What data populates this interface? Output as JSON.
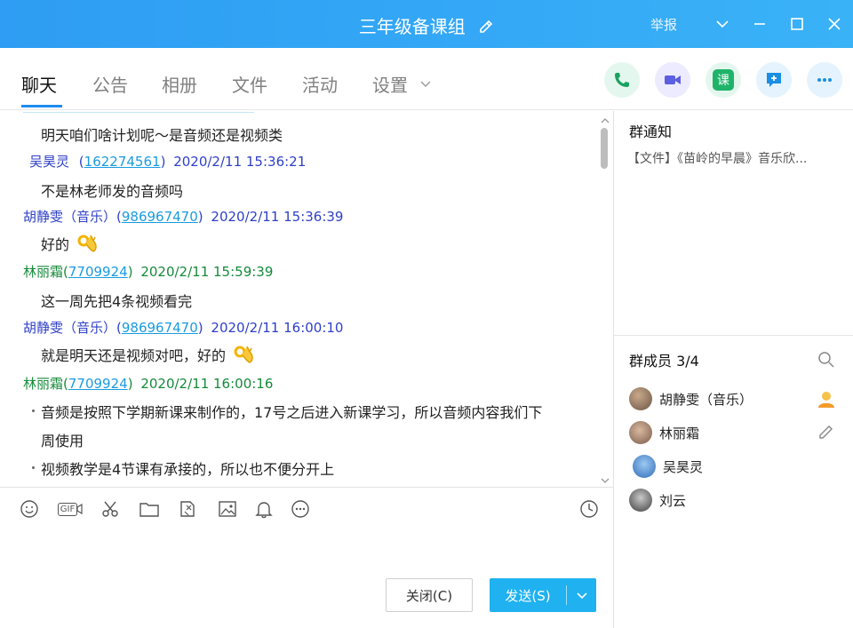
{
  "window": {
    "title": "三年级备课组",
    "report_label": "举报"
  },
  "tabs": [
    {
      "label": "聊天",
      "active": true
    },
    {
      "label": "公告",
      "active": false
    },
    {
      "label": "相册",
      "active": false
    },
    {
      "label": "文件",
      "active": false
    },
    {
      "label": "活动",
      "active": false
    },
    {
      "label": "设置",
      "active": false
    }
  ],
  "toolbar_icons": [
    "phone-icon",
    "video-call-icon",
    "course-icon",
    "share-screen-icon",
    "more-icon"
  ],
  "course_icon_text": "课",
  "messages": [
    {
      "type": "body",
      "text": "明天咱们啥计划呢～是音频还是视频类"
    },
    {
      "type": "sender",
      "name": "吴昊灵",
      "qq": "162274561",
      "time": "2020/2/11 15:36:21",
      "color": "#2f40c8"
    },
    {
      "type": "body",
      "text": "不是林老师发的音频吗"
    },
    {
      "type": "sender",
      "name": "胡静雯（音乐）",
      "qq": "986967470",
      "time": "2020/2/11 15:36:39",
      "color": "#2f40c8"
    },
    {
      "type": "body",
      "text": "好的",
      "emoji": "ok-hand"
    },
    {
      "type": "sender",
      "name": "林丽霜",
      "qq": "7709924",
      "time": "2020/2/11 15:59:39",
      "color": "#158a3a"
    },
    {
      "type": "body",
      "text": "这一周先把4条视频看完"
    },
    {
      "type": "sender",
      "name": "胡静雯（音乐）",
      "qq": "986967470",
      "time": "2020/2/11 16:00:10",
      "color": "#2f40c8"
    },
    {
      "type": "body",
      "text": "就是明天还是视频对吧，好的",
      "emoji": "ok-hand"
    },
    {
      "type": "sender",
      "name": "林丽霜",
      "qq": "7709924",
      "time": "2020/2/11 16:00:16",
      "color": "#158a3a"
    },
    {
      "type": "bullet",
      "text": "音频是按照下学期新课来制作的，17号之后进入新课学习，所以音频内容我们下"
    },
    {
      "type": "body",
      "text": "周使用"
    },
    {
      "type": "bullet",
      "text": "视频教学是4节课有承接的，所以也不便分开上"
    }
  ],
  "input_tools": [
    "emoji-icon",
    "gif-icon",
    "scissors-icon",
    "folder-icon",
    "file-transfer-icon",
    "image-icon",
    "bell-icon",
    "more-options-icon",
    "history-icon"
  ],
  "gif_label": "GIF",
  "buttons": {
    "close": "关闭(C)",
    "send": "发送(S)"
  },
  "notice": {
    "title": "群通知",
    "text": "【文件】《苗岭的早晨》音乐欣..."
  },
  "members": {
    "title": "群成员 3/4",
    "list": [
      {
        "name": "胡静雯（音乐）",
        "avatar_color": "#7b6a5a",
        "extra_icon": "admin-icon"
      },
      {
        "name": "林丽霜",
        "avatar_color": "#8a6f5e",
        "extra_icon": "edit-icon"
      },
      {
        "name": "吴昊灵",
        "avatar_color": "#3a7bc8",
        "extra_icon": ""
      },
      {
        "name": "刘云",
        "avatar_color": "#555555",
        "extra_icon": ""
      }
    ]
  },
  "colors": {
    "title_bar": "#2e9df3",
    "accent": "#1e8bf0",
    "send_button": "#1fb1f0",
    "qq_link": "#1a9be0"
  }
}
